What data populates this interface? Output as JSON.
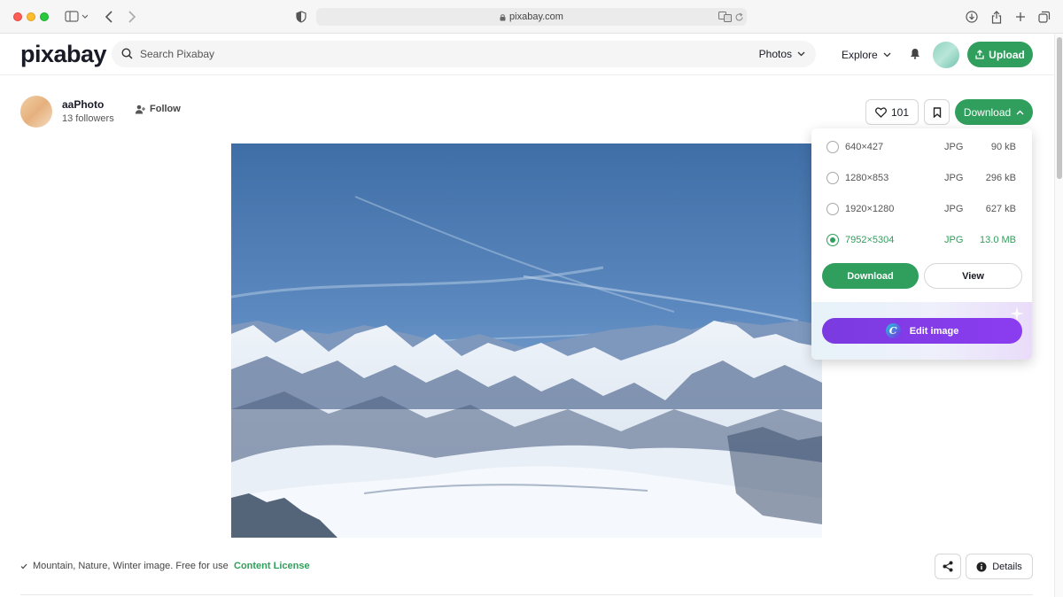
{
  "browser": {
    "url": "pixabay.com"
  },
  "header": {
    "logo": "pixabay",
    "search_placeholder": "Search Pixabay",
    "search_type": "Photos",
    "explore_label": "Explore",
    "upload_label": "Upload"
  },
  "author": {
    "name": "aaPhoto",
    "followers": "13 followers",
    "follow_label": "Follow"
  },
  "actions": {
    "likes": "101",
    "download_label": "Download"
  },
  "download_menu": {
    "options": [
      {
        "resolution": "640×427",
        "format": "JPG",
        "size": "90 kB",
        "selected": false
      },
      {
        "resolution": "1280×853",
        "format": "JPG",
        "size": "296 kB",
        "selected": false
      },
      {
        "resolution": "1920×1280",
        "format": "JPG",
        "size": "627 kB",
        "selected": false
      },
      {
        "resolution": "7952×5304",
        "format": "JPG",
        "size": "13.0 MB",
        "selected": true
      }
    ],
    "download_label": "Download",
    "view_label": "View",
    "edit_label": "Edit image",
    "canva_letter": "C"
  },
  "footer": {
    "caption": "Mountain, Nature, Winter image. Free for use",
    "license_label": "Content License",
    "details_label": "Details"
  },
  "colors": {
    "accent": "#309e5c",
    "edit_button": "#7b3ae0"
  }
}
